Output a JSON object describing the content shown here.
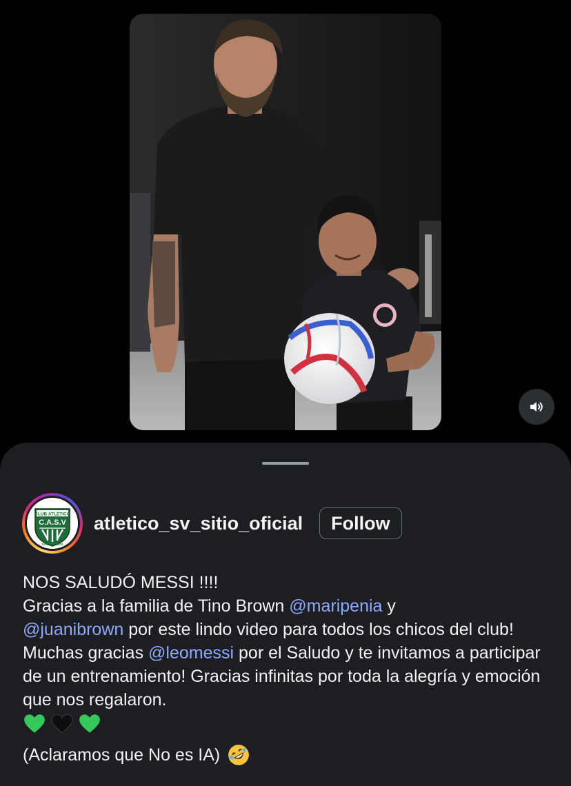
{
  "video": {
    "mute_icon": "speaker-icon"
  },
  "post": {
    "username": "atletico_sv_sitio_oficial",
    "follow_label": "Follow",
    "avatar_logo": {
      "top_text": "CLUB ATLÉTICO",
      "initials": "C.A.S.V",
      "bottom_text": "SAN VICENTE"
    },
    "caption": {
      "title": "NOS SALUDÓ MESSI !!!!",
      "part1": "Gracias a la familia de Tino Brown ",
      "mention1": "@maripenia",
      "part2": " y",
      "mention2": "@juanibrown",
      "part3": " por este lindo video para todos los chicos del club! Muchas gracias ",
      "mention3": "@leomessi",
      "part4": " por el Saludo y te invitamos a participar de un entrenamiento! Gracias infinitas por toda la alegría y emoción que nos regalaron.",
      "emojis": [
        "green-heart-icon",
        "black-heart-icon",
        "green-heart-icon"
      ],
      "closing": "(Aclaramos que No es IA)",
      "closing_emoji": "rolling-laughing-face-icon"
    }
  },
  "colors": {
    "background": "#000000",
    "sheet": "#1c1e21",
    "mention": "#8fa8ff",
    "text": "#f5f5f5"
  }
}
